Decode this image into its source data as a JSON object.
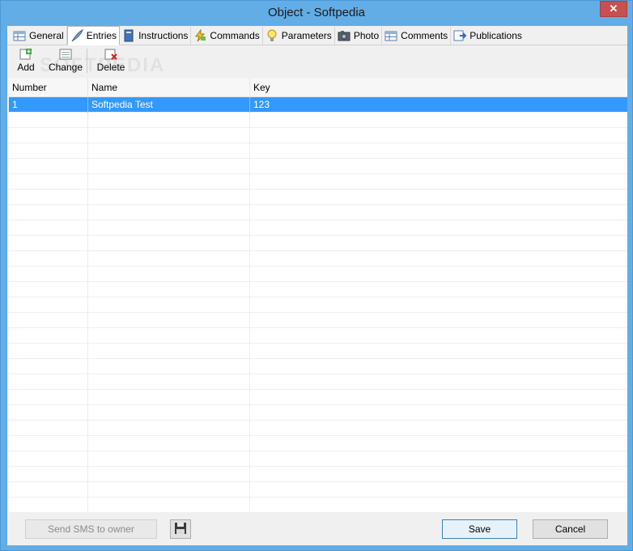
{
  "window": {
    "title": "Object - Softpedia",
    "close_glyph": "✕"
  },
  "tabs": [
    {
      "label": "General",
      "icon": "table-icon",
      "active": false
    },
    {
      "label": "Entries",
      "icon": "feather-icon",
      "active": true
    },
    {
      "label": "Instructions",
      "icon": "book-icon",
      "active": false
    },
    {
      "label": "Commands",
      "icon": "lightning-icon",
      "active": false
    },
    {
      "label": "Parameters",
      "icon": "lightbulb-icon",
      "active": false
    },
    {
      "label": "Photo",
      "icon": "camera-icon",
      "active": false
    },
    {
      "label": "Comments",
      "icon": "table-icon",
      "active": false
    },
    {
      "label": "Publications",
      "icon": "export-icon",
      "active": false
    }
  ],
  "toolbar": {
    "add_label": "Add",
    "change_label": "Change",
    "delete_label": "Delete",
    "watermark": "SOFTPEDIA"
  },
  "grid": {
    "columns": [
      "Number",
      "Name",
      "Key"
    ],
    "rows": [
      [
        "1",
        "Softpedia Test",
        "123"
      ]
    ],
    "selected_row": 0
  },
  "footer": {
    "sms_label": "Send SMS to owner",
    "save_label": "Save",
    "cancel_label": "Cancel"
  },
  "colors": {
    "title_bar": "#62ade6",
    "selection": "#3399ff",
    "close_button": "#c75050"
  }
}
